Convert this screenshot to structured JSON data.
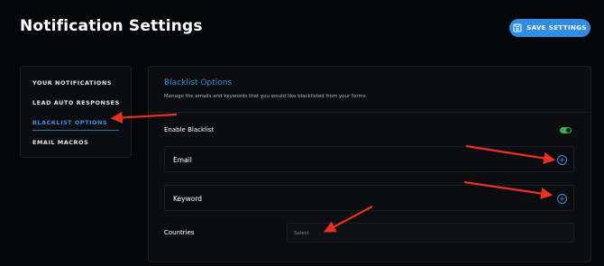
{
  "header": {
    "title": "Notification Settings",
    "save_label": "SAVE SETTINGS",
    "save_icon": "save-icon"
  },
  "sidebar": {
    "items": [
      {
        "label": "YOUR NOTIFICATIONS",
        "active": false
      },
      {
        "label": "LEAD AUTO RESPONSES",
        "active": false
      },
      {
        "label": "BLACKLIST OPTIONS",
        "active": true
      },
      {
        "label": "EMAIL MACROS",
        "active": false
      }
    ]
  },
  "panel": {
    "title": "Blacklist Options",
    "description": "Manage the emails and keywords that you would like blacklisted from your forms.",
    "enable_label": "Enable Blacklist",
    "enable_on": true,
    "email_label": "Email",
    "keyword_label": "Keyword",
    "countries_label": "Countries",
    "countries_placeholder": "Select"
  },
  "colors": {
    "accent": "#2f8de4",
    "toggle_on": "#2fb34f",
    "annotation_arrow": "#e8311f",
    "background": "#050608"
  }
}
